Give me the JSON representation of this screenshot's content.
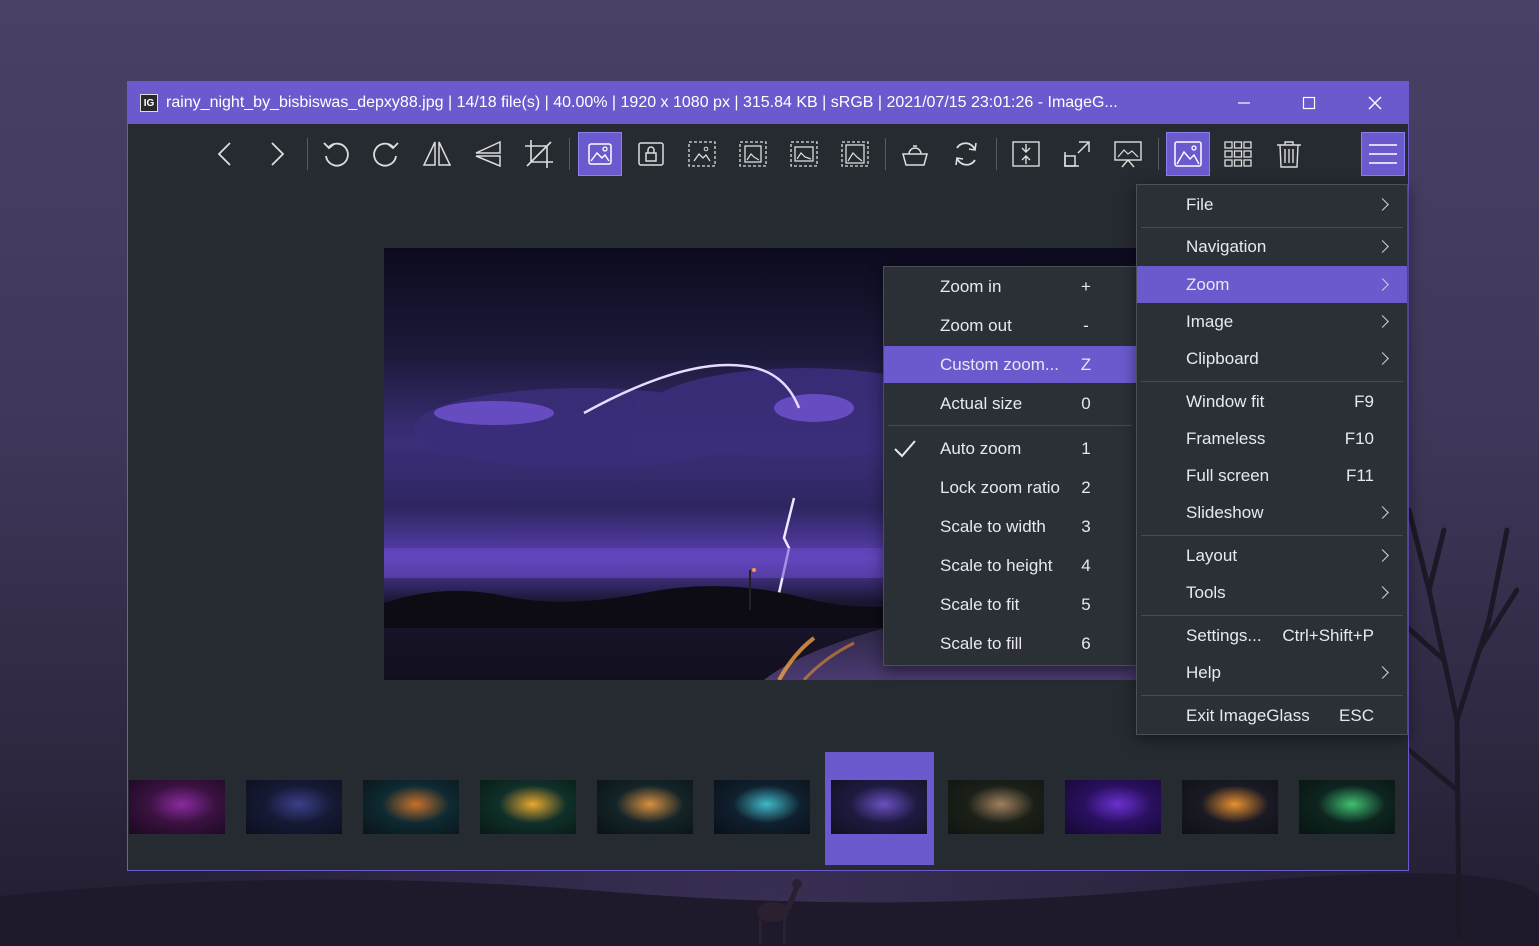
{
  "window": {
    "title": "rainy_night_by_bisbiswas_depxy88.jpg  |  14/18 file(s)  |  40.00%  |  1920 x 1080 px  |  315.84 KB  |  sRGB  |  2021/07/15 23:01:26  - ImageG...",
    "app_icon_text": "IG",
    "accent": "#6a5acd",
    "background": "#262b31"
  },
  "toolbar": {
    "buttons": [
      {
        "name": "previous-image",
        "icon": "chevron-left-icon"
      },
      {
        "name": "next-image",
        "icon": "chevron-right-icon"
      },
      {
        "name": "rotate-left",
        "icon": "rotate-left-icon"
      },
      {
        "name": "rotate-right",
        "icon": "rotate-right-icon"
      },
      {
        "name": "flip-horizontal",
        "icon": "flip-horizontal-icon"
      },
      {
        "name": "flip-vertical",
        "icon": "flip-vertical-icon"
      },
      {
        "name": "crop",
        "icon": "crop-icon"
      },
      {
        "name": "auto-zoom",
        "icon": "image-icon",
        "active": true
      },
      {
        "name": "lock-zoom-ratio",
        "icon": "lock-image-icon"
      },
      {
        "name": "scale-to-width",
        "icon": "scale-width-icon"
      },
      {
        "name": "scale-to-height",
        "icon": "scale-height-icon"
      },
      {
        "name": "scale-to-fit",
        "icon": "scale-fit-icon"
      },
      {
        "name": "scale-to-fill",
        "icon": "scale-fill-icon"
      },
      {
        "name": "checkerboard",
        "icon": "basket-icon"
      },
      {
        "name": "refresh",
        "icon": "refresh-icon"
      },
      {
        "name": "window-fit",
        "icon": "window-fit-icon"
      },
      {
        "name": "full-screen",
        "icon": "full-screen-icon"
      },
      {
        "name": "slideshow",
        "icon": "slideshow-icon"
      },
      {
        "name": "thumbnail-bar",
        "icon": "thumbnail-bar-icon",
        "active": true
      },
      {
        "name": "gallery",
        "icon": "grid-icon"
      },
      {
        "name": "delete",
        "icon": "trash-icon"
      },
      {
        "name": "main-menu",
        "icon": "hamburger-icon",
        "active": true
      }
    ]
  },
  "main_menu": {
    "items": [
      {
        "label": "File",
        "submenu": true
      },
      {
        "label": "Navigation",
        "submenu": true
      },
      {
        "label": "Zoom",
        "submenu": true,
        "highlighted": true
      },
      {
        "label": "Image",
        "submenu": true
      },
      {
        "label": "Clipboard",
        "submenu": true
      },
      {
        "label": "Window fit",
        "shortcut": "F9"
      },
      {
        "label": "Frameless",
        "shortcut": "F10"
      },
      {
        "label": "Full screen",
        "shortcut": "F11"
      },
      {
        "label": "Slideshow",
        "submenu": true
      },
      {
        "label": "Layout",
        "submenu": true
      },
      {
        "label": "Tools",
        "submenu": true
      },
      {
        "label": "Settings...",
        "shortcut": "Ctrl+Shift+P"
      },
      {
        "label": "Help",
        "submenu": true
      },
      {
        "label": "Exit ImageGlass",
        "shortcut": "ESC"
      }
    ]
  },
  "zoom_menu": {
    "items": [
      {
        "label": "Zoom in",
        "shortcut": "+"
      },
      {
        "label": "Zoom out",
        "shortcut": "-"
      },
      {
        "label": "Custom zoom...",
        "shortcut": "Z",
        "highlighted": true
      },
      {
        "label": "Actual size",
        "shortcut": "0"
      },
      {
        "label": "Auto zoom",
        "shortcut": "1",
        "checked": true
      },
      {
        "label": "Lock zoom ratio",
        "shortcut": "2"
      },
      {
        "label": "Scale to width",
        "shortcut": "3"
      },
      {
        "label": "Scale to height",
        "shortcut": "4"
      },
      {
        "label": "Scale to fit",
        "shortcut": "5"
      },
      {
        "label": "Scale to fill",
        "shortcut": "6"
      }
    ]
  },
  "thumbnails": {
    "selected_index": 6,
    "items": [
      {
        "colors": [
          "#3a1240",
          "#8a2aa0",
          "#1a0820"
        ]
      },
      {
        "colors": [
          "#151a35",
          "#3b3f8a",
          "#0d0f1d"
        ]
      },
      {
        "colors": [
          "#0e2a33",
          "#c8702a",
          "#0a1418"
        ]
      },
      {
        "colors": [
          "#10302a",
          "#e8a830",
          "#081812"
        ]
      },
      {
        "colors": [
          "#142428",
          "#d89040",
          "#0a1214"
        ]
      },
      {
        "colors": [
          "#10202e",
          "#40b8c8",
          "#081018"
        ]
      },
      {
        "colors": [
          "#1e1a40",
          "#6a50c0",
          "#121020"
        ]
      },
      {
        "colors": [
          "#1a2018",
          "#a08060",
          "#101410"
        ]
      },
      {
        "colors": [
          "#2a1060",
          "#6a30d0",
          "#140830"
        ]
      },
      {
        "colors": [
          "#1a1a24",
          "#e89030",
          "#101018"
        ]
      },
      {
        "colors": [
          "#0e2420",
          "#40c070",
          "#081410"
        ]
      }
    ]
  }
}
